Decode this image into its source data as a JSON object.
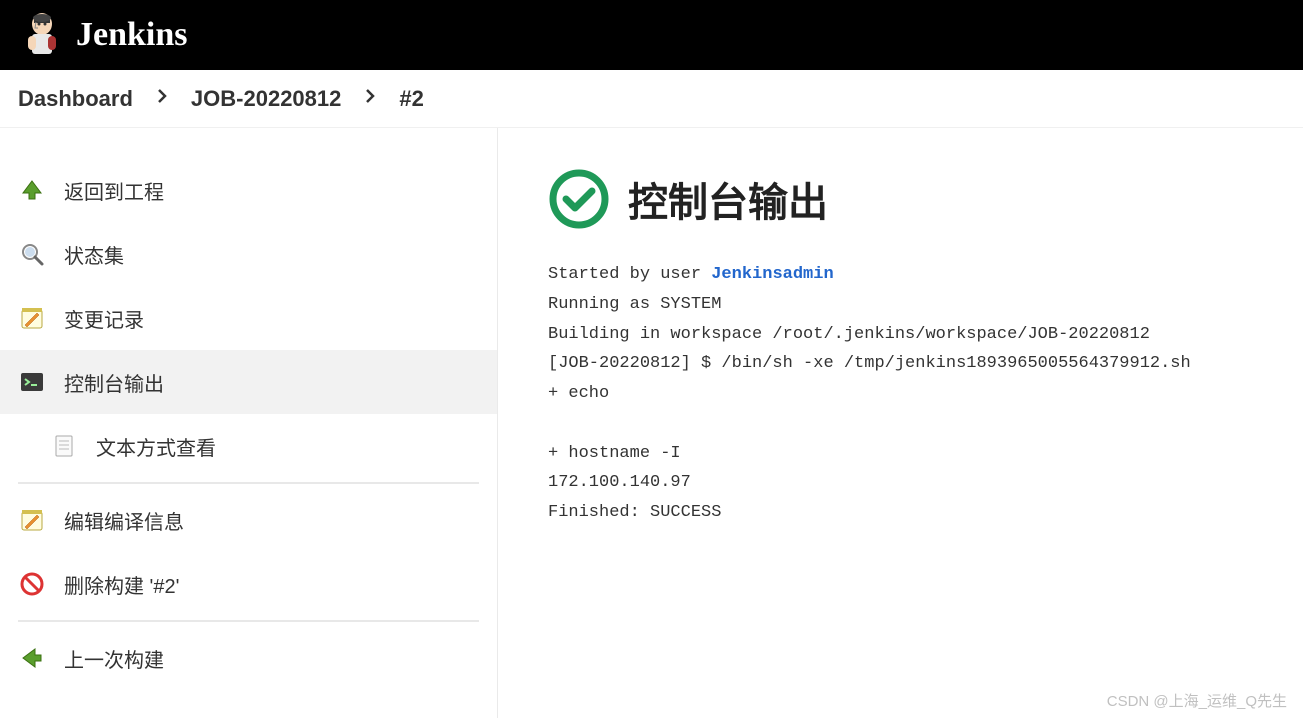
{
  "header": {
    "brand": "Jenkins"
  },
  "breadcrumb": {
    "items": [
      "Dashboard",
      "JOB-20220812",
      "#2"
    ]
  },
  "sidebar": {
    "back": "返回到工程",
    "status": "状态集",
    "changes": "变更记录",
    "console": "控制台输出",
    "console_text": "文本方式查看",
    "edit_build": "编辑编译信息",
    "delete_build": "删除构建 '#2'",
    "prev_build": "上一次构建"
  },
  "main": {
    "title": "控制台输出",
    "console": {
      "started_by": "Started by user ",
      "user": "Jenkinsadmin",
      "lines": "Running as SYSTEM\nBuilding in workspace /root/.jenkins/workspace/JOB-20220812\n[JOB-20220812] $ /bin/sh -xe /tmp/jenkins1893965005564379912.sh\n+ echo\n\n+ hostname -I\n172.100.140.97\nFinished: SUCCESS"
    }
  },
  "watermark": "CSDN @上海_运维_Q先生"
}
